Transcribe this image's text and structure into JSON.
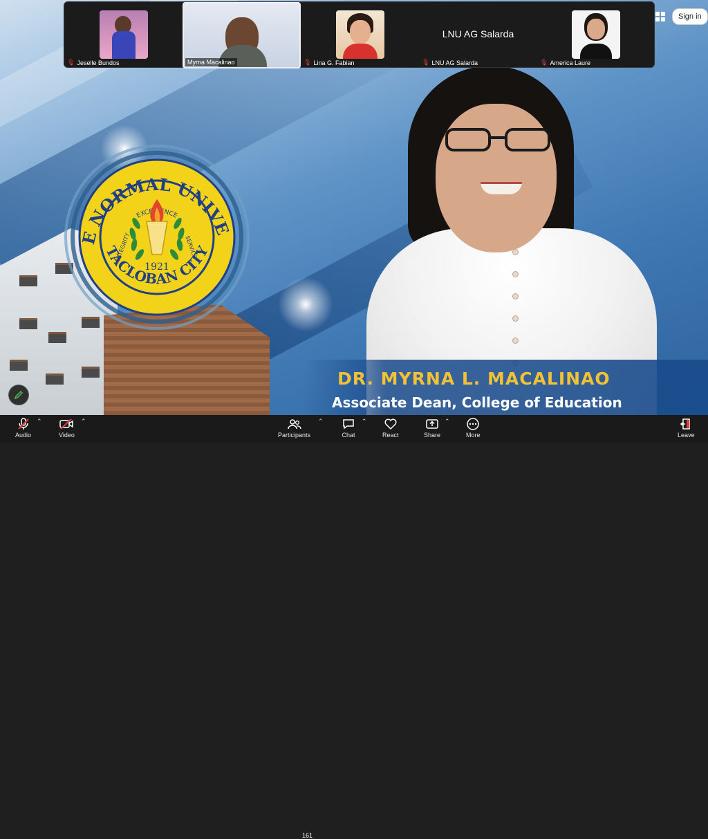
{
  "gallery": {
    "participants": [
      {
        "name": "Jeselle Bundos",
        "muted": true
      },
      {
        "name": "Myrna Macalinao",
        "muted": false
      },
      {
        "name": "Lina G. Fabian",
        "muted": true
      },
      {
        "name": "LNU AG Salarda",
        "muted": true,
        "display_text": "LNU AG Salarda"
      },
      {
        "name": "America Laure",
        "muted": true
      }
    ]
  },
  "top_right": {
    "signin_label": "Sign in"
  },
  "shared_screen": {
    "seal": {
      "outer_text": "LEYTE NORMAL UNIVERSITY",
      "bottom_text": "TACLOBAN CITY",
      "top_word": "EXCELLENCE",
      "left_word": "INTEGRITY",
      "right_word": "SERVICE",
      "year": "1921"
    },
    "speaker_name": "DR. MYRNA L. MACALINAO",
    "speaker_role": "Associate Dean, College of Education"
  },
  "toolbar": {
    "audio_label": "Audio",
    "video_label": "Video",
    "participants_label": "Participants",
    "participants_count": "161",
    "chat_label": "Chat",
    "react_label": "React",
    "share_label": "Share",
    "more_label": "More",
    "leave_label": "Leave"
  },
  "colors": {
    "name_gold": "#f2c234",
    "leave_red": "#e0403c",
    "seal_gold": "#f3d21a",
    "seal_navy": "#1f3f86"
  }
}
